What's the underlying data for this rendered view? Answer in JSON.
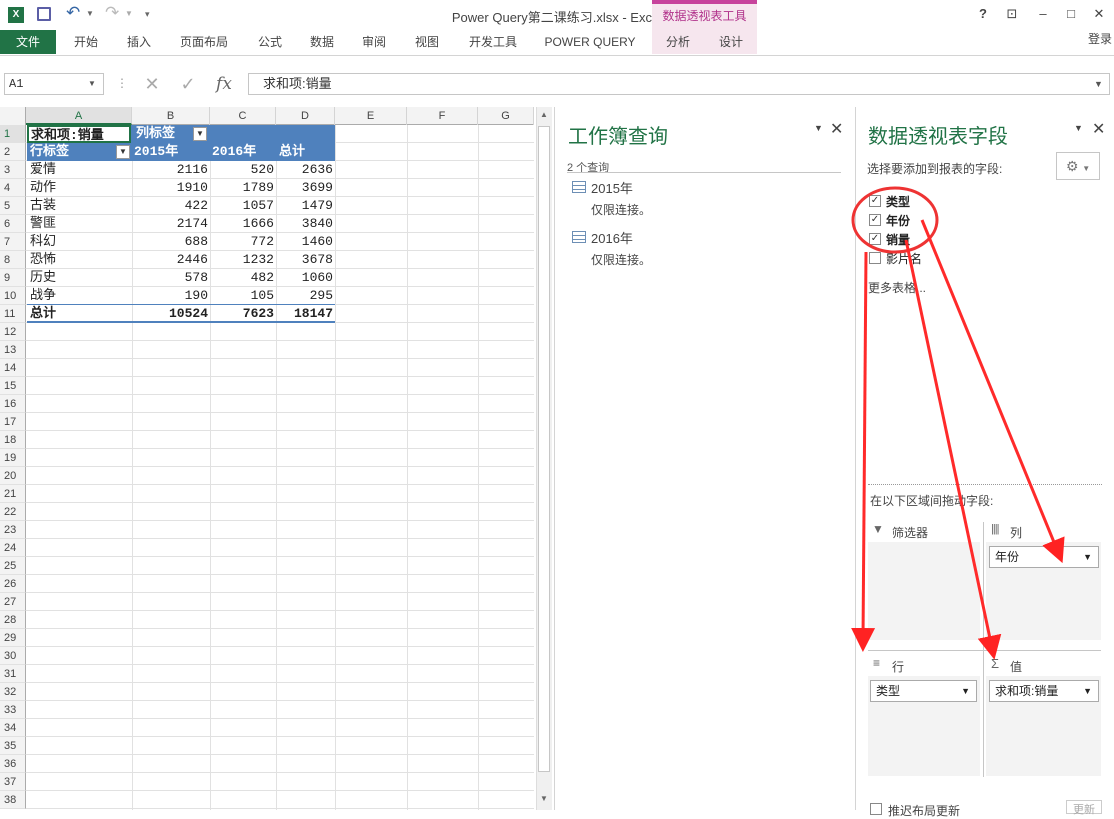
{
  "window": {
    "title": "Power Query第二课练习.xlsx - Excel",
    "context_tab_group": "数据透视表工具",
    "sign_in": "登录",
    "help": "?",
    "restore_ribbon": "⊡",
    "minimize": "–",
    "maximize": "□",
    "close": "✕"
  },
  "quick_access": {
    "excel": "X",
    "save": "💾",
    "undo": "↶",
    "redo": "↷",
    "customize": "▾"
  },
  "ribbon": {
    "tabs": [
      "文件",
      "开始",
      "插入",
      "页面布局",
      "公式",
      "数据",
      "审阅",
      "视图",
      "开发工具",
      "POWER QUERY"
    ],
    "context_tabs": [
      "分析",
      "设计"
    ]
  },
  "formula_bar": {
    "name_box": "A1",
    "cancel": "✕",
    "enter": "✓",
    "fx": "fx",
    "formula": "求和项:销量"
  },
  "sheet": {
    "columns": [
      "A",
      "B",
      "C",
      "D",
      "E",
      "F",
      "G"
    ],
    "rows": [
      "1",
      "2",
      "3",
      "4",
      "5",
      "6",
      "7",
      "8",
      "9",
      "10",
      "11",
      "12",
      "13",
      "14",
      "15",
      "16",
      "17",
      "18",
      "19",
      "20",
      "21",
      "22",
      "23",
      "24",
      "25",
      "26",
      "27",
      "28",
      "29",
      "30",
      "31",
      "32",
      "33",
      "34",
      "35",
      "36",
      "37",
      "38"
    ],
    "pivot": {
      "corner": "求和项:销量",
      "col_label": "列标签",
      "row_label": "行标签",
      "col_headers": [
        "2015年",
        "2016年",
        "总计"
      ],
      "rows": [
        {
          "label": "爱情",
          "v": [
            "2116",
            "520",
            "2636"
          ]
        },
        {
          "label": "动作",
          "v": [
            "1910",
            "1789",
            "3699"
          ]
        },
        {
          "label": "古装",
          "v": [
            "422",
            "1057",
            "1479"
          ]
        },
        {
          "label": "警匪",
          "v": [
            "2174",
            "1666",
            "3840"
          ]
        },
        {
          "label": "科幻",
          "v": [
            "688",
            "772",
            "1460"
          ]
        },
        {
          "label": "恐怖",
          "v": [
            "2446",
            "1232",
            "3678"
          ]
        },
        {
          "label": "历史",
          "v": [
            "578",
            "482",
            "1060"
          ]
        },
        {
          "label": "战争",
          "v": [
            "190",
            "105",
            "295"
          ]
        }
      ],
      "total": {
        "label": "总计",
        "v": [
          "10524",
          "7623",
          "18147"
        ]
      }
    }
  },
  "query_pane": {
    "title": "工作簿查询",
    "count": "2 个查询",
    "queries": [
      {
        "name": "2015年",
        "desc": "仅限连接。"
      },
      {
        "name": "2016年",
        "desc": "仅限连接。"
      }
    ]
  },
  "pivot_pane": {
    "title": "数据透视表字段",
    "prompt": "选择要添加到报表的字段:",
    "fields": [
      {
        "name": "类型",
        "checked": true
      },
      {
        "name": "年份",
        "checked": true
      },
      {
        "name": "销量",
        "checked": true
      },
      {
        "name": "影片名",
        "checked": false
      }
    ],
    "more": "更多表格...",
    "drag_prompt": "在以下区域间拖动字段:",
    "areas": {
      "filter": "筛选器",
      "columns": "列",
      "rows": "行",
      "values": "值"
    },
    "columns_field": "年份",
    "rows_field": "类型",
    "values_field": "求和项:销量",
    "defer": "推迟布局更新",
    "update": "更新"
  }
}
